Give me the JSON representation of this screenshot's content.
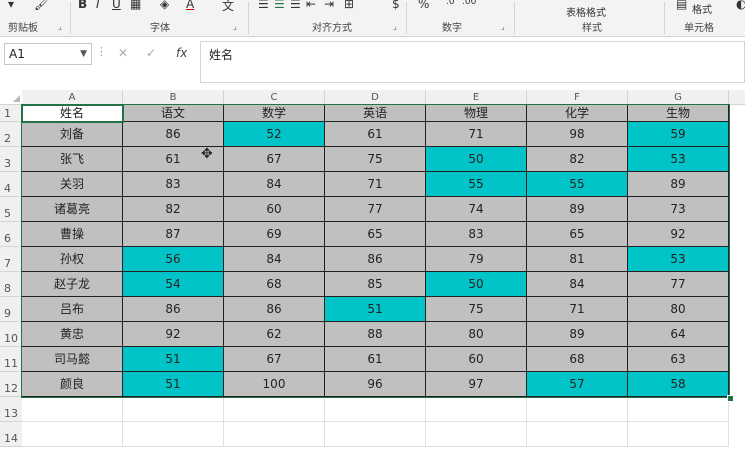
{
  "ribbon": {
    "groups": [
      {
        "label": "剪贴板"
      },
      {
        "label": "字体"
      },
      {
        "label": "对齐方式"
      },
      {
        "label": "数字"
      },
      {
        "label": "样式"
      },
      {
        "label": "单元格"
      }
    ],
    "table_format_label": "表格格式",
    "format_label": "格式",
    "bold_label": "B",
    "italic_label": "I",
    "underline_label": "U",
    "percent_label": "%"
  },
  "formula_bar": {
    "name_box": "A1",
    "fx_label": "fx",
    "content": "姓名"
  },
  "sheet": {
    "columns": [
      "A",
      "B",
      "C",
      "D",
      "E",
      "F",
      "G"
    ],
    "row_numbers": [
      "1",
      "2",
      "3",
      "4",
      "5",
      "6",
      "7",
      "8",
      "9",
      "10",
      "11",
      "12",
      "13",
      "14"
    ],
    "headers": [
      "姓名",
      "语文",
      "数学",
      "英语",
      "物理",
      "化学",
      "生物"
    ],
    "rows": [
      {
        "name": "刘备",
        "values": [
          "86",
          "52",
          "61",
          "71",
          "98",
          "59"
        ]
      },
      {
        "name": "张飞",
        "values": [
          "61",
          "67",
          "75",
          "50",
          "82",
          "53"
        ]
      },
      {
        "name": "关羽",
        "values": [
          "83",
          "84",
          "71",
          "55",
          "55",
          "89"
        ]
      },
      {
        "name": "诸葛亮",
        "values": [
          "82",
          "60",
          "77",
          "74",
          "89",
          "73"
        ]
      },
      {
        "name": "曹操",
        "values": [
          "87",
          "69",
          "65",
          "83",
          "65",
          "92"
        ]
      },
      {
        "name": "孙权",
        "values": [
          "56",
          "84",
          "86",
          "79",
          "81",
          "53"
        ]
      },
      {
        "name": "赵子龙",
        "values": [
          "54",
          "68",
          "85",
          "50",
          "84",
          "77"
        ]
      },
      {
        "name": "吕布",
        "values": [
          "86",
          "86",
          "51",
          "75",
          "71",
          "80"
        ]
      },
      {
        "name": "黄忠",
        "values": [
          "92",
          "62",
          "88",
          "80",
          "89",
          "64"
        ]
      },
      {
        "name": "司马懿",
        "values": [
          "51",
          "67",
          "61",
          "60",
          "68",
          "63"
        ]
      },
      {
        "name": "颜良",
        "values": [
          "51",
          "100",
          "96",
          "97",
          "57",
          "58"
        ]
      }
    ],
    "highlight_color": "#00c4c8",
    "cell_fill_color": "#c0c0c0",
    "selection_color": "#217346"
  }
}
